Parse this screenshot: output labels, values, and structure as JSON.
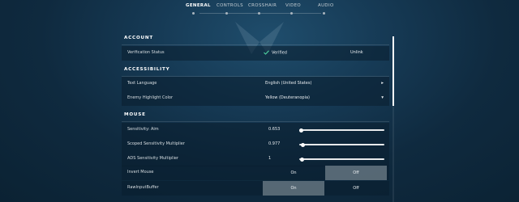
{
  "tabs": [
    {
      "label": "GENERAL",
      "active": true
    },
    {
      "label": "CONTROLS",
      "active": false
    },
    {
      "label": "CROSSHAIR",
      "active": false
    },
    {
      "label": "VIDEO",
      "active": false
    },
    {
      "label": "AUDIO",
      "active": false
    }
  ],
  "account": {
    "title": "ACCOUNT",
    "verification_label": "Verification Status",
    "verified_text": "Verified",
    "unlink_label": "Unlink"
  },
  "accessibility": {
    "title": "ACCESSIBILITY",
    "text_language_label": "Text Language",
    "text_language_value": "English (United States)",
    "enemy_highlight_label": "Enemy Highlight Color",
    "enemy_highlight_value": "Yellow (Deuteranopia)"
  },
  "mouse": {
    "title": "MOUSE",
    "sliders": [
      {
        "label": "Sensitivity: Aim",
        "value": "0.653",
        "fraction": 0.02
      },
      {
        "label": "Scoped Sensitivity Multiplier",
        "value": "0.977",
        "fraction": 0.04
      },
      {
        "label": "ADS Sensitivity Multiplier",
        "value": "1",
        "fraction": 0.03
      }
    ],
    "invert_mouse": {
      "label": "Invert Mouse",
      "on": "On",
      "off": "Off",
      "selected": "Off"
    },
    "raw_input": {
      "label": "RawInputBuffer",
      "on": "On",
      "off": "Off",
      "selected": "On"
    }
  },
  "colors": {
    "accent_check": "#4fd6a0",
    "selected_option": "#8e9aa3"
  }
}
